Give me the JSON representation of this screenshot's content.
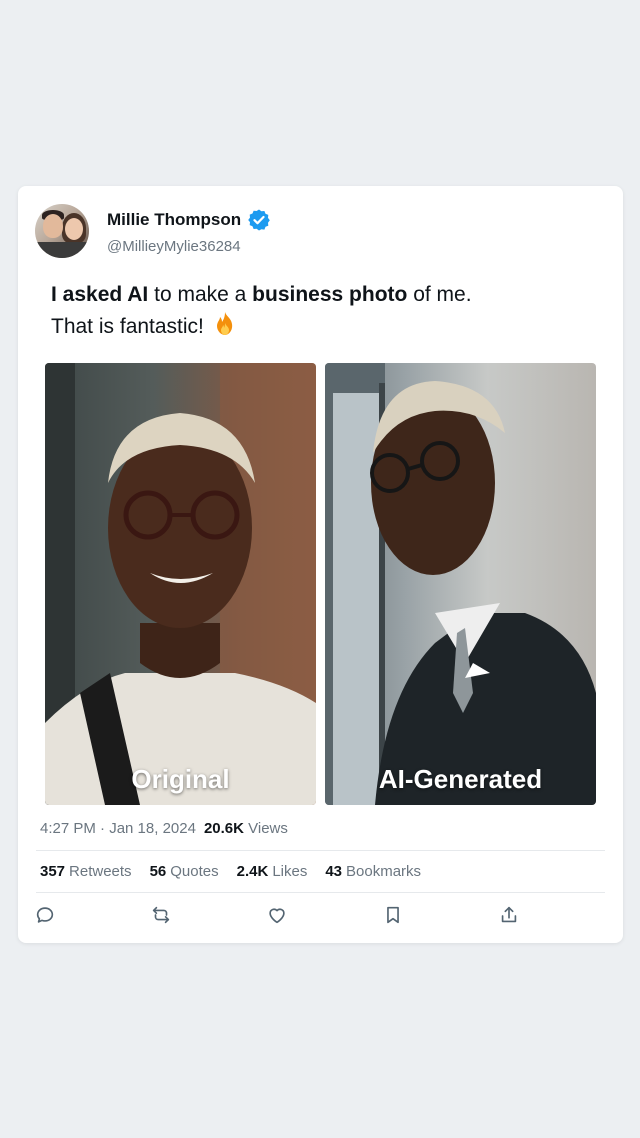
{
  "tweet": {
    "author": {
      "name": "Millie Thompson",
      "handle": "@MillieyMylie36284",
      "verified": true
    },
    "text": {
      "line1": [
        {
          "t": "I asked AI",
          "bold": true
        },
        {
          "t": " to make a ",
          "bold": false
        },
        {
          "t": "business photo",
          "bold": true
        },
        {
          "t": " of me.",
          "bold": false
        }
      ],
      "line2": "That is fantastic!",
      "emoji": "fire-icon"
    },
    "images": [
      {
        "caption": "Original"
      },
      {
        "caption": "AI-Generated"
      }
    ],
    "meta": {
      "time": "4:27 PM · Jan 18, 2024",
      "views_count": "20.6K",
      "views_label": "Views"
    },
    "stats": [
      {
        "count": "357",
        "label": "Retweets"
      },
      {
        "count": "56",
        "label": "Quotes"
      },
      {
        "count": "2.4K",
        "label": "Likes"
      },
      {
        "count": "43",
        "label": "Bookmarks"
      }
    ],
    "actions": [
      "reply-icon",
      "retweet-icon",
      "like-icon",
      "bookmark-icon",
      "share-icon"
    ]
  },
  "colors": {
    "verified": "#1d9bf0",
    "icon": "#536471",
    "secondary_text": "#6b7680",
    "background": "#eceff2"
  }
}
